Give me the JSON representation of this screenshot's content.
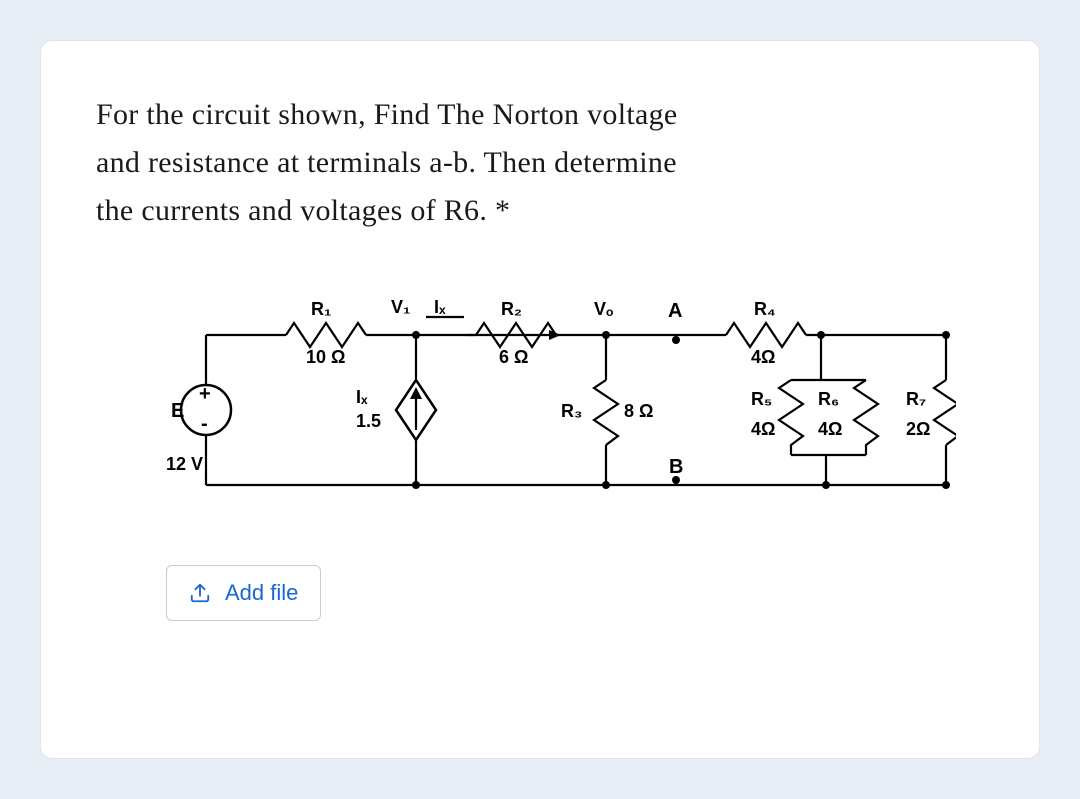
{
  "question": {
    "line1": "For the circuit shown, Find The Norton voltage",
    "line2": "and resistance at terminals a-b. Then determine",
    "line3": "the currents and voltages of R6. *"
  },
  "circuit": {
    "source": {
      "name": "E",
      "value": "12 V",
      "polarity_plus": "+",
      "polarity_minus": "-"
    },
    "dep_source": {
      "gain": "1.5",
      "control_label": "Iₓ"
    },
    "top_labels": {
      "v1": "V₁",
      "ix": "Iₓ"
    },
    "nodes": {
      "vo": "Vₒ",
      "a": "A",
      "b": "B"
    },
    "resistors": {
      "r1": {
        "name": "R₁",
        "value": "10 Ω"
      },
      "r2": {
        "name": "R₂",
        "value": "6 Ω"
      },
      "r3": {
        "name": "R₃",
        "value": "8 Ω"
      },
      "r4": {
        "name": "R₄",
        "value": "4Ω"
      },
      "r5": {
        "name": "R₅",
        "value": "4Ω"
      },
      "r6": {
        "name": "R₆",
        "value": "4Ω"
      },
      "r7": {
        "name": "R₇",
        "value": "2Ω"
      }
    }
  },
  "buttons": {
    "add_file": "Add file"
  }
}
